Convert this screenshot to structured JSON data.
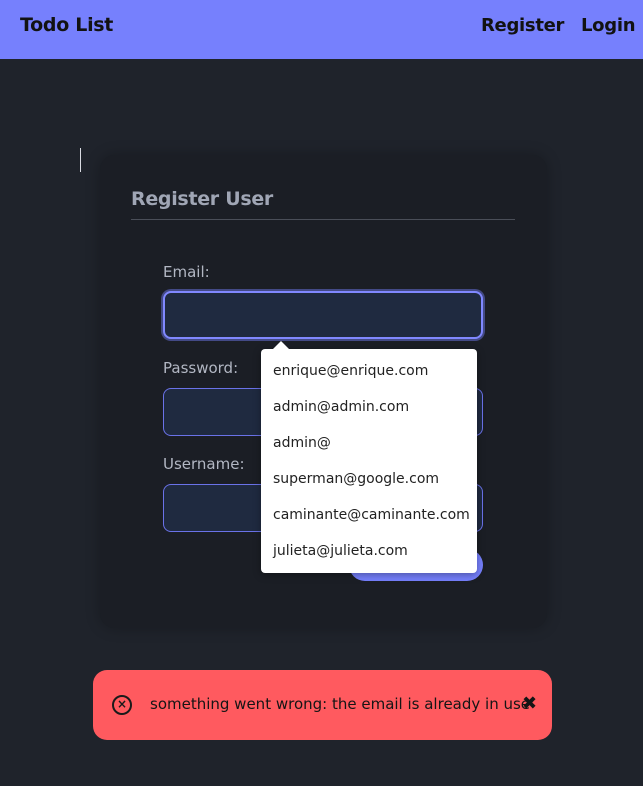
{
  "navbar": {
    "brand": "Todo List",
    "register": "Register",
    "login": "Login"
  },
  "form": {
    "title": "Register User",
    "email_label": "Email:",
    "password_label": "Password:",
    "username_label": "Username:",
    "email_value": "",
    "password_value": "",
    "username_value": ""
  },
  "autocomplete": [
    "enrique@enrique.com",
    "admin@admin.com",
    "admin@",
    "superman@google.com",
    "caminante@caminante.com",
    "julieta@julieta.com"
  ],
  "toast": {
    "message": "something went wrong: the email is already in use",
    "icon": "error-circle-icon",
    "close_icon": "close-x-icon"
  },
  "colors": {
    "accent": "#7680fd",
    "background": "#1f232b",
    "card": "#1b1e25",
    "error": "#ff5a5f"
  }
}
